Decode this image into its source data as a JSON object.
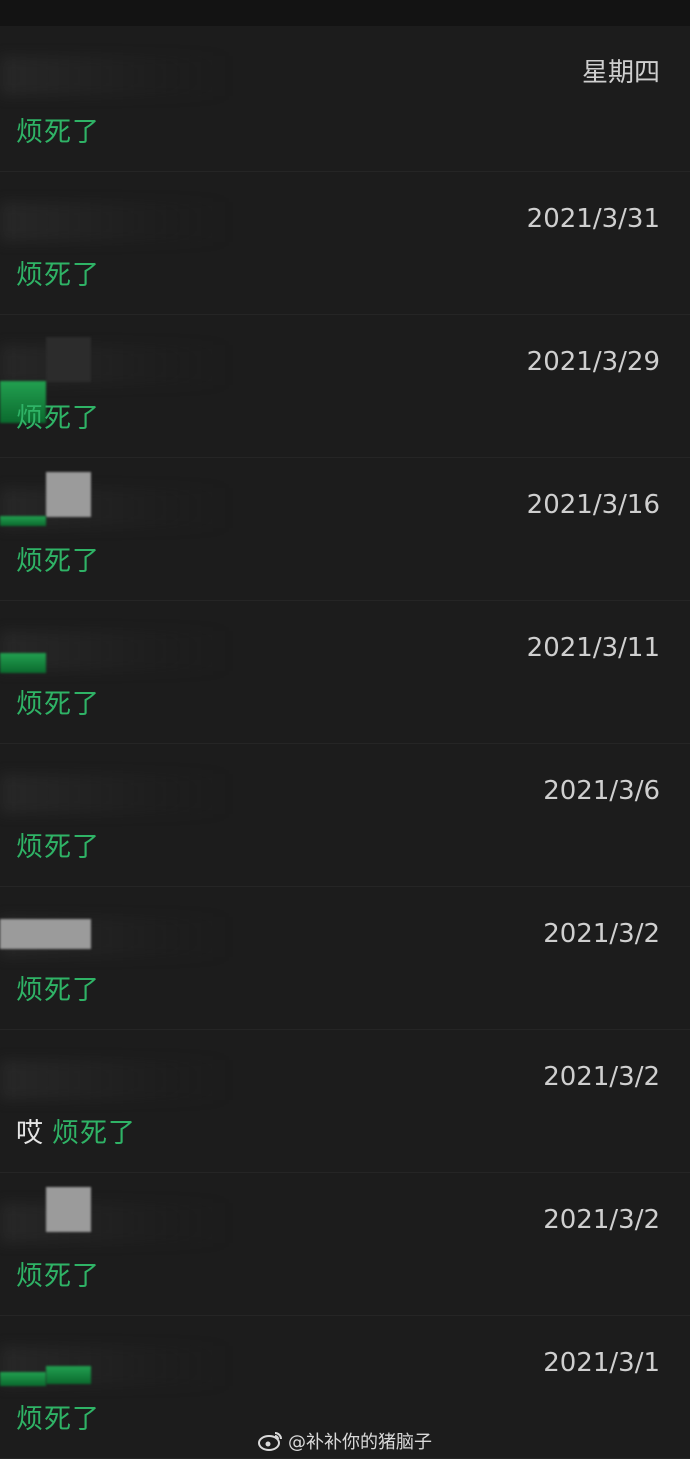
{
  "conversations": [
    {
      "date": "星期四",
      "prefix": "",
      "message": "烦死了"
    },
    {
      "date": "2021/3/31",
      "prefix": "",
      "message": "烦死了"
    },
    {
      "date": "2021/3/29",
      "prefix": "",
      "message": "烦死了"
    },
    {
      "date": "2021/3/16",
      "prefix": "",
      "message": "烦死了"
    },
    {
      "date": "2021/3/11",
      "prefix": "",
      "message": "烦死了"
    },
    {
      "date": "2021/3/6",
      "prefix": "",
      "message": "烦死了"
    },
    {
      "date": "2021/3/2",
      "prefix": "",
      "message": "烦死了"
    },
    {
      "date": "2021/3/2",
      "prefix": "哎",
      "message": "烦死了"
    },
    {
      "date": "2021/3/2",
      "prefix": "",
      "message": "烦死了"
    },
    {
      "date": "2021/3/1",
      "prefix": "",
      "message": "烦死了"
    }
  ],
  "watermark": {
    "text": "@补补你的猪脑子",
    "icon": "weibo-logo-icon"
  },
  "colors": {
    "background": "#1c1c1c",
    "message_green": "#2fb366",
    "date_text": "#cfcfcf"
  }
}
